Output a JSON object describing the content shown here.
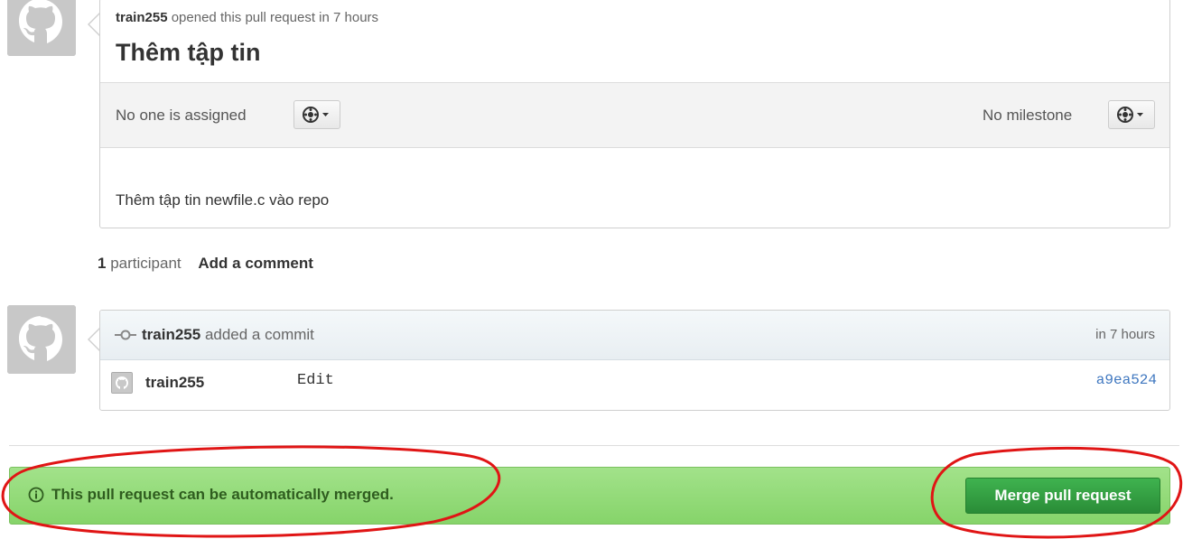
{
  "issue": {
    "author": "train255",
    "opened_text": "opened this pull request in 7 hours",
    "title": "Thêm tập tin",
    "assignee_text": "No one is assigned",
    "milestone_text": "No milestone",
    "body": "Thêm tập tin newfile.c vào repo"
  },
  "participants": {
    "count": "1",
    "label": "participant",
    "add_comment": "Add a comment"
  },
  "commit_event": {
    "author": "train255",
    "action": "added a commit",
    "time": "in 7 hours",
    "commit": {
      "author": "train255",
      "message": "Edit",
      "sha": "a9ea524"
    }
  },
  "merge": {
    "status_text": "This pull request can be automatically merged.",
    "button_label": "Merge pull request"
  },
  "colors": {
    "merge_bar": "#8fd975",
    "merge_button": "#2f9a3c",
    "annotation": "#e01515",
    "sha_link": "#4078c0"
  }
}
